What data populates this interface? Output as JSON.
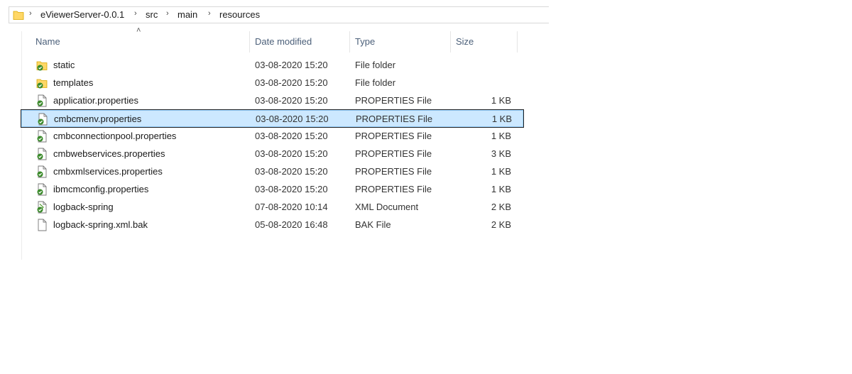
{
  "breadcrumb": {
    "items": [
      "eViewerServer-0.0.1",
      "src",
      "main",
      "resources"
    ]
  },
  "columns": {
    "name": "Name",
    "date": "Date modified",
    "type": "Type",
    "size": "Size"
  },
  "files": [
    {
      "name": "static",
      "date": "03-08-2020 15:20",
      "type": "File folder",
      "size": "",
      "icon": "folder-icon"
    },
    {
      "name": "templates",
      "date": "03-08-2020 15:20",
      "type": "File folder",
      "size": "",
      "icon": "folder-icon"
    },
    {
      "name": "applicatior.properties",
      "date": "03-08-2020 15:20",
      "type": "PROPERTIES File",
      "size": "1 KB",
      "icon": "properties-file-icon"
    },
    {
      "name": "cmbcmenv.properties",
      "date": "03-08-2020 15:20",
      "type": "PROPERTIES File",
      "size": "1 KB",
      "icon": "properties-file-icon",
      "selected": true
    },
    {
      "name": "cmbconnectionpool.properties",
      "date": "03-08-2020 15:20",
      "type": "PROPERTIES File",
      "size": "1 KB",
      "icon": "properties-file-icon"
    },
    {
      "name": "cmbwebservices.properties",
      "date": "03-08-2020 15:20",
      "type": "PROPERTIES File",
      "size": "3 KB",
      "icon": "properties-file-icon"
    },
    {
      "name": "cmbxmlservices.properties",
      "date": "03-08-2020 15:20",
      "type": "PROPERTIES File",
      "size": "1 KB",
      "icon": "properties-file-icon"
    },
    {
      "name": "ibmcmconfig.properties",
      "date": "03-08-2020 15:20",
      "type": "PROPERTIES File",
      "size": "1 KB",
      "icon": "properties-file-icon"
    },
    {
      "name": "logback-spring",
      "date": "07-08-2020 10:14",
      "type": "XML Document",
      "size": "2 KB",
      "icon": "xml-file-icon"
    },
    {
      "name": "logback-spring.xml.bak",
      "date": "05-08-2020 16:48",
      "type": "BAK File",
      "size": "2 KB",
      "icon": "blank-file-icon"
    }
  ],
  "colors": {
    "selection_bg": "#cce8ff",
    "selection_border": "#99d1ff",
    "folder_yellow": "#ffd766",
    "check_green": "#3a8a2a"
  }
}
